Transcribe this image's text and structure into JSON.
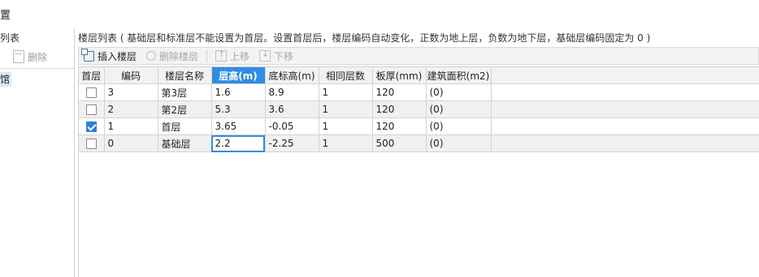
{
  "window": {
    "title": "置"
  },
  "left_pane": {
    "label": "列表",
    "toolbar": {
      "add_label": "",
      "delete_label": "删除"
    },
    "items": [
      {
        "label": "馆"
      }
    ]
  },
  "main": {
    "label": "楼层列表 ( 基础层和标准层不能设置为首层。设置首层后，楼层编码自动变化，正数为地上层，负数为地下层，基础层编码固定为 0 )",
    "toolbar": {
      "insert_label": "插入楼层",
      "delete_label": "删除楼层",
      "up_label": "上移",
      "down_label": "下移"
    },
    "table": {
      "headers": [
        "首层",
        "编码",
        "楼层名称",
        "层高(m)",
        "底标高(m)",
        "相同层数",
        "板厚(mm)",
        "建筑面积(m2)"
      ],
      "active_column": "层高(m)",
      "rows": [
        {
          "first_floor": false,
          "code": "3",
          "name": "第3层",
          "height": "1.6",
          "base_elev": "8.9",
          "same_count": "1",
          "slab": "120",
          "area": "(0)"
        },
        {
          "first_floor": false,
          "code": "2",
          "name": "第2层",
          "height": "5.3",
          "base_elev": "3.6",
          "same_count": "1",
          "slab": "120",
          "area": "(0)"
        },
        {
          "first_floor": true,
          "code": "1",
          "name": "首层",
          "height": "3.65",
          "base_elev": "-0.05",
          "same_count": "1",
          "slab": "120",
          "area": "(0)"
        },
        {
          "first_floor": false,
          "code": "0",
          "name": "基础层",
          "height": "2.2",
          "base_elev": "-2.25",
          "same_count": "1",
          "slab": "500",
          "area": "(0)"
        }
      ]
    }
  },
  "colors": {
    "accent": "#2f8de4",
    "checkbox_checked": "#2f7fd6",
    "row_alt": "#f0f0f0",
    "toolbar_bg": "#f3f3f3"
  }
}
